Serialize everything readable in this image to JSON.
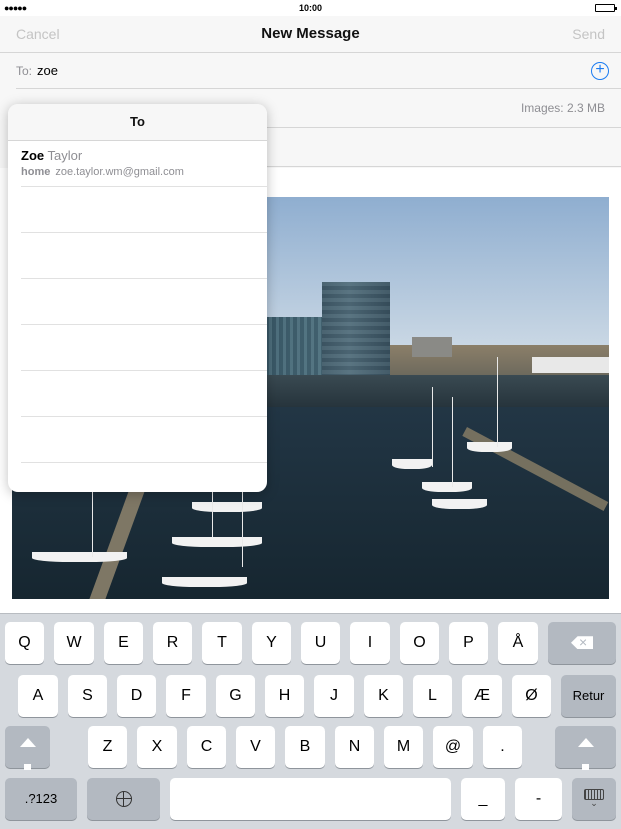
{
  "status_bar": {
    "signal": "●●●●●",
    "time": "10:00",
    "battery_level": 1.0
  },
  "nav": {
    "cancel": "Cancel",
    "title": "New Message",
    "send": "Send"
  },
  "to_field": {
    "label": "To:",
    "value": "zoe",
    "add_icon": "plus-circle-icon"
  },
  "cc_field": {
    "images_size": "Images: 2.3 MB"
  },
  "popover": {
    "header": "To",
    "suggestions": [
      {
        "first_name": "Zoe",
        "last_name": "Taylor",
        "kind": "home",
        "email": "zoe.taylor.wm@gmail.com"
      }
    ]
  },
  "keyboard": {
    "row1": [
      "Q",
      "W",
      "E",
      "R",
      "T",
      "Y",
      "U",
      "I",
      "O",
      "P",
      "Å"
    ],
    "row2": [
      "A",
      "S",
      "D",
      "F",
      "G",
      "H",
      "J",
      "K",
      "L",
      "Æ",
      "Ø"
    ],
    "row3": [
      "Z",
      "X",
      "C",
      "V",
      "B",
      "N",
      "M",
      "@",
      "."
    ],
    "return_label": "Retur",
    "numbers_label": ".?123",
    "underscore": "_",
    "dash": "-",
    "icons": {
      "backspace": "backspace-icon",
      "shift": "shift-icon",
      "globe": "globe-icon",
      "dismiss": "keyboard-dismiss-icon"
    }
  }
}
